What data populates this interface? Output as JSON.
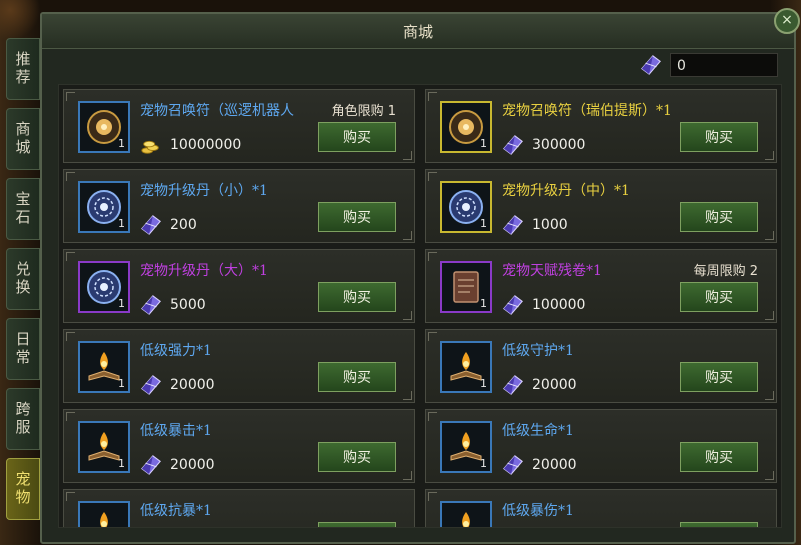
{
  "window": {
    "title": "商城",
    "close_glyph": "×"
  },
  "side_tabs": [
    "推荐",
    "商城",
    "宝石",
    "兑换",
    "日常",
    "跨服",
    "宠物"
  ],
  "currency": {
    "value": "0",
    "icon": "crystal-gem-icon"
  },
  "buy_label": "购买",
  "items": [
    {
      "name": "宠物召唤符（巡逻机器人",
      "color": "blue",
      "frame": "blue",
      "qty": "1",
      "price": "10000000",
      "currency": "gold-coins-icon",
      "limit": "角色限购 1",
      "icon": "summon-orb-icon"
    },
    {
      "name": "宠物召唤符（瑞伯提斯）*1",
      "color": "gold",
      "frame": "gold",
      "qty": "1",
      "price": "300000",
      "currency": "crystal-gem-icon",
      "limit": "",
      "icon": "summon-orb-icon"
    },
    {
      "name": "宠物升级丹（小）*1",
      "color": "blue",
      "frame": "blue",
      "qty": "1",
      "price": "200",
      "currency": "crystal-gem-icon",
      "limit": "",
      "icon": "upgrade-pill-icon"
    },
    {
      "name": "宠物升级丹（中）*1",
      "color": "gold",
      "frame": "gold",
      "qty": "1",
      "price": "1000",
      "currency": "crystal-gem-icon",
      "limit": "",
      "icon": "upgrade-pill-icon"
    },
    {
      "name": "宠物升级丹（大）*1",
      "color": "purple",
      "frame": "purple",
      "qty": "1",
      "price": "5000",
      "currency": "crystal-gem-icon",
      "limit": "",
      "icon": "upgrade-pill-icon"
    },
    {
      "name": "宠物天赋残卷*1",
      "color": "purple",
      "frame": "purple",
      "qty": "1",
      "price": "100000",
      "currency": "crystal-gem-icon",
      "limit": "每周限购 2",
      "icon": "talent-scroll-icon"
    },
    {
      "name": "低级强力*1",
      "color": "blue",
      "frame": "blue",
      "qty": "1",
      "price": "20000",
      "currency": "crystal-gem-icon",
      "limit": "",
      "icon": "skill-book-icon"
    },
    {
      "name": "低级守护*1",
      "color": "blue",
      "frame": "blue",
      "qty": "1",
      "price": "20000",
      "currency": "crystal-gem-icon",
      "limit": "",
      "icon": "skill-book-icon"
    },
    {
      "name": "低级暴击*1",
      "color": "blue",
      "frame": "blue",
      "qty": "1",
      "price": "20000",
      "currency": "crystal-gem-icon",
      "limit": "",
      "icon": "skill-book-icon"
    },
    {
      "name": "低级生命*1",
      "color": "blue",
      "frame": "blue",
      "qty": "1",
      "price": "20000",
      "currency": "crystal-gem-icon",
      "limit": "",
      "icon": "skill-book-icon"
    },
    {
      "name": "低级抗暴*1",
      "color": "blue",
      "frame": "blue",
      "qty": "",
      "price": "",
      "currency": "crystal-gem-icon",
      "limit": "",
      "icon": "skill-book-icon"
    },
    {
      "name": "低级暴伤*1",
      "color": "blue",
      "frame": "blue",
      "qty": "",
      "price": "",
      "currency": "crystal-gem-icon",
      "limit": "",
      "icon": "skill-book-icon"
    }
  ],
  "colors": {
    "blue": "#5ea8f0",
    "gold": "#e8d040",
    "purple": "#c040e0",
    "button": "#3e6a30"
  }
}
